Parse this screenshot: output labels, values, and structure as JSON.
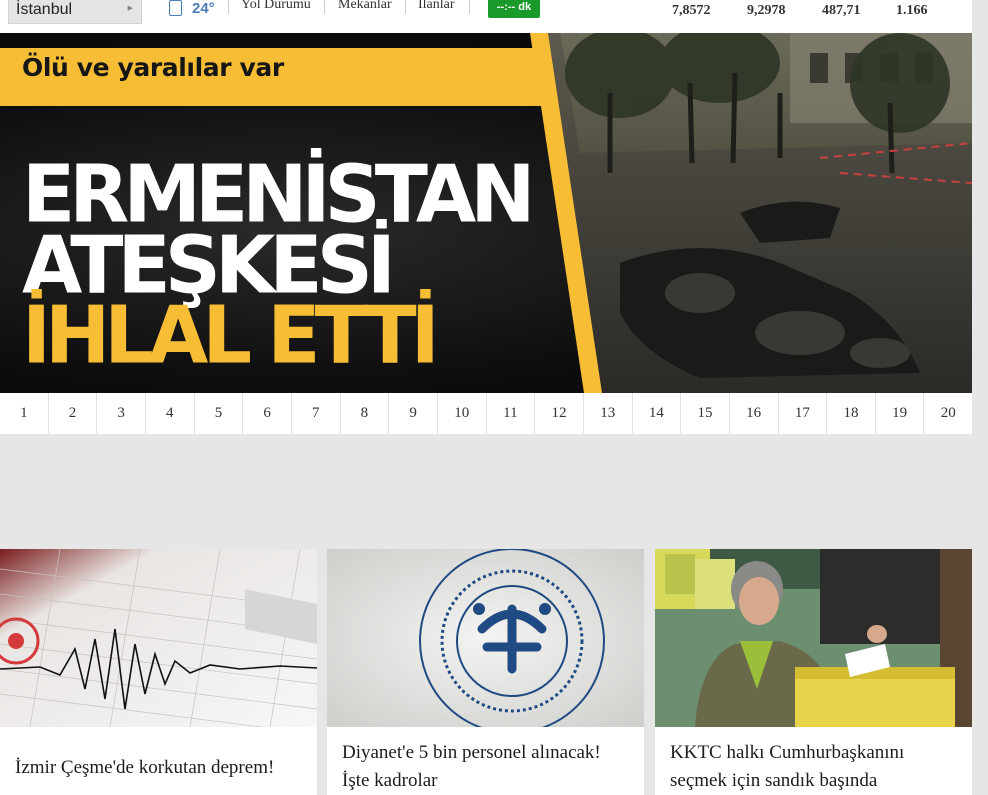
{
  "topbar": {
    "city": "İstanbul",
    "temperature": "24°",
    "nav": [
      "Yol Durumu",
      "Mekanlar",
      "İlanlar"
    ],
    "prayer_time": "--:-- dk",
    "markets": [
      "7,8572",
      "9,2978",
      "487,71",
      "1.166"
    ]
  },
  "hero": {
    "tag": "Ölü ve yaralılar var",
    "headline_line1": "ERMENİSTAN",
    "headline_line2": "ATEŞKESİ",
    "headline_line3": "İHLAL ETTİ",
    "accent_color": "#f6bd35"
  },
  "pager": {
    "pages": [
      "1",
      "2",
      "3",
      "4",
      "5",
      "6",
      "7",
      "8",
      "9",
      "10",
      "11",
      "12",
      "13",
      "14",
      "15",
      "16",
      "17",
      "18",
      "19",
      "20"
    ]
  },
  "cards": [
    {
      "caption": "İzmir Çeşme'de korkutan deprem!"
    },
    {
      "caption": "Diyanet'e 5 bin personel alınacak! İşte kadrolar"
    },
    {
      "caption": "KKTC halkı Cumhurbaşkanını seçmek için sandık başında"
    }
  ]
}
